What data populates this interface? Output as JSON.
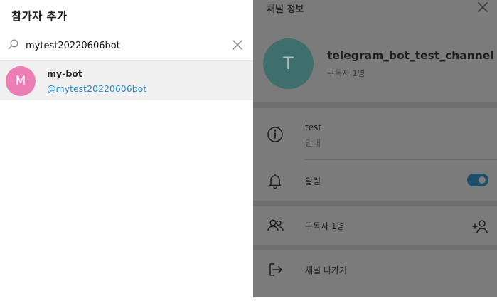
{
  "dialog": {
    "title": "참가자 추가",
    "search": {
      "value": "mytest20220606bot",
      "placeholder": ""
    },
    "icons": {
      "search": "search-icon",
      "clear": "close-icon"
    },
    "results": [
      {
        "avatar_letter": "M",
        "name": "my-bot",
        "username": "@mytest20220606bot",
        "avatar_color": "#ec7eb6"
      }
    ]
  },
  "panel": {
    "title": "채널 정보",
    "channel": {
      "avatar_letter": "T",
      "name": "telegram_bot_test_channel",
      "subscribers": "구독자 1명"
    },
    "description": {
      "text": "test",
      "label": "안내"
    },
    "notifications": {
      "label": "알림",
      "enabled": true
    },
    "members": {
      "label": "구독자 1명"
    },
    "leave": {
      "label": "채널 나가기"
    }
  },
  "colors": {
    "accent": "#2a8fcf",
    "overlay": "#7b7b7b",
    "channel_avatar": "#3f6f6c"
  }
}
